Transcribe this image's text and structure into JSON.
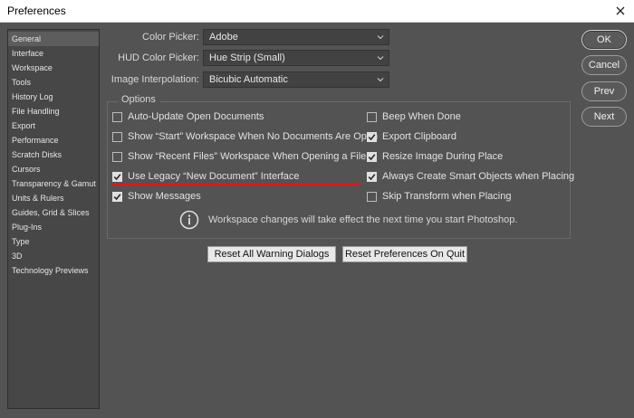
{
  "window": {
    "title": "Preferences"
  },
  "sidebar": {
    "items": [
      {
        "label": "General"
      },
      {
        "label": "Interface"
      },
      {
        "label": "Workspace"
      },
      {
        "label": "Tools"
      },
      {
        "label": "History Log"
      },
      {
        "label": "File Handling"
      },
      {
        "label": "Export"
      },
      {
        "label": "Performance"
      },
      {
        "label": "Scratch Disks"
      },
      {
        "label": "Cursors"
      },
      {
        "label": "Transparency & Gamut"
      },
      {
        "label": "Units & Rulers"
      },
      {
        "label": "Guides, Grid & Slices"
      },
      {
        "label": "Plug-Ins"
      },
      {
        "label": "Type"
      },
      {
        "label": "3D"
      },
      {
        "label": "Technology Previews"
      }
    ],
    "active_index": 0
  },
  "settings": {
    "color_picker": {
      "label": "Color Picker:",
      "value": "Adobe"
    },
    "hud_color_picker": {
      "label": "HUD Color Picker:",
      "value": "Hue Strip (Small)"
    },
    "image_interpolation": {
      "label": "Image Interpolation:",
      "value": "Bicubic Automatic"
    }
  },
  "options": {
    "legend": "Options",
    "left": [
      {
        "label": "Auto-Update Open Documents",
        "checked": false
      },
      {
        "label": "Show “Start” Workspace When No Documents Are Open",
        "checked": false
      },
      {
        "label": "Show “Recent Files” Workspace When Opening a File",
        "checked": false
      },
      {
        "label": "Use Legacy “New Document” Interface",
        "checked": true
      },
      {
        "label": "Show Messages",
        "checked": true
      }
    ],
    "right": [
      {
        "label": "Beep When Done",
        "checked": false
      },
      {
        "label": "Export Clipboard",
        "checked": true
      },
      {
        "label": "Resize Image During Place",
        "checked": true
      },
      {
        "label": "Always Create Smart Objects when Placing",
        "checked": true
      },
      {
        "label": "Skip Transform when Placing",
        "checked": false
      }
    ],
    "info": "Workspace changes will take effect the next time you start Photoshop."
  },
  "reset": {
    "warnings_label": "Reset All Warning Dialogs",
    "prefs_label": "Reset Preferences On Quit"
  },
  "actions": {
    "ok_label": "OK",
    "cancel_label": "Cancel",
    "prev_label": "Prev",
    "next_label": "Next"
  },
  "colors": {
    "background": "#535353",
    "highlight_line": "#e0151b"
  }
}
